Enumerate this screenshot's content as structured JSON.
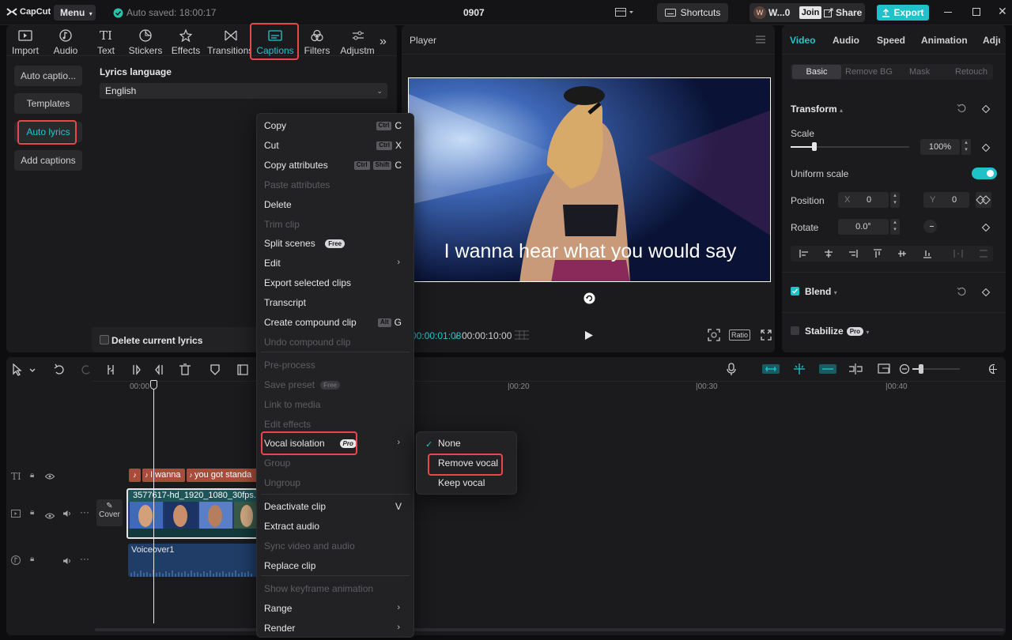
{
  "app": {
    "logo": "CapCut",
    "menu_label": "Menu",
    "auto_saved": "Auto saved: 18:00:17",
    "project_name": "0907",
    "shortcuts": "Shortcuts",
    "user_initial": "W",
    "user_name": "W...0",
    "join": "Join",
    "share": "Share",
    "export": "Export"
  },
  "toolbar": {
    "tabs": [
      "Import",
      "Audio",
      "Text",
      "Stickers",
      "Effects",
      "Transitions",
      "Captions",
      "Filters",
      "Adjustm"
    ]
  },
  "captions": {
    "side": [
      "Auto captio...",
      "Templates",
      "Auto lyrics",
      "Add captions"
    ],
    "lang_label": "Lyrics language",
    "lang_value": "English",
    "delete_label": "Delete current lyrics"
  },
  "player": {
    "title": "Player",
    "subtitle": "I wanna hear what you would say",
    "time_current": "00:00:01:08",
    "time_total": "00:00:10:00",
    "ratio": "Ratio"
  },
  "inspector": {
    "tabs": [
      "Video",
      "Audio",
      "Speed",
      "Animation",
      "Adju"
    ],
    "subtabs": [
      "Basic",
      "Remove BG",
      "Mask",
      "Retouch"
    ],
    "transform": "Transform",
    "scale": "Scale",
    "scale_value": "100%",
    "uniform_scale": "Uniform scale",
    "position": "Position",
    "x_label": "X",
    "x_value": "0",
    "y_label": "Y",
    "y_value": "0",
    "rotate": "Rotate",
    "rotate_value": "0.0°",
    "blend": "Blend",
    "stabilize": "Stabilize",
    "pro": "Pro",
    "scale_level": 0.1
  },
  "timeline": {
    "ticks": [
      "00:00",
      "|00:20",
      "|00:30",
      "|00:40"
    ],
    "caption_clips": [
      "I wanna",
      "you got standa"
    ],
    "video_clip": "3577617-hd_1920_1080_30fps.mp",
    "cover": "Cover",
    "voiceover": "Voiceover1"
  },
  "context_menu": {
    "items": [
      {
        "label": "Copy",
        "keys": [
          "Ctrl"
        ],
        "key": "C",
        "disabled": false
      },
      {
        "label": "Cut",
        "keys": [
          "Ctrl"
        ],
        "key": "X",
        "disabled": false
      },
      {
        "label": "Copy attributes",
        "keys": [
          "Ctrl",
          "Shift"
        ],
        "key": "C",
        "disabled": false
      },
      {
        "label": "Paste attributes",
        "disabled": true
      },
      {
        "label": "Delete",
        "disabled": false
      },
      {
        "label": "Trim clip",
        "disabled": true
      },
      {
        "label": "Split scenes",
        "badge": "Free",
        "disabled": false
      },
      {
        "label": "Edit",
        "arrow": true,
        "disabled": false
      },
      {
        "label": "Export selected clips",
        "disabled": false
      },
      {
        "label": "Transcript",
        "disabled": false
      },
      {
        "label": "Create compound clip",
        "keys": [
          "Alt"
        ],
        "key": "G",
        "disabled": false
      },
      {
        "label": "Undo compound clip",
        "disabled": true
      },
      {
        "label": "Pre-process",
        "disabled": true
      },
      {
        "label": "Save preset",
        "badge": "Free",
        "disabled": true
      },
      {
        "label": "Link to media",
        "disabled": true
      },
      {
        "label": "Edit effects",
        "disabled": true
      },
      {
        "label": "Vocal isolation",
        "badge": "Pro",
        "arrow": true,
        "disabled": false
      },
      {
        "label": "Group",
        "disabled": true
      },
      {
        "label": "Ungroup",
        "disabled": true
      },
      {
        "label": "Deactivate clip",
        "key": "V",
        "disabled": false
      },
      {
        "label": "Extract audio",
        "disabled": false
      },
      {
        "label": "Sync video and audio",
        "disabled": true
      },
      {
        "label": "Replace clip",
        "disabled": false
      },
      {
        "label": "Show keyframe animation",
        "disabled": true
      },
      {
        "label": "Range",
        "arrow": true,
        "disabled": false
      },
      {
        "label": "Render",
        "arrow": true,
        "disabled": false
      }
    ]
  },
  "submenu": {
    "items": [
      "None",
      "Remove vocal",
      "Keep vocal"
    ],
    "checked": "None"
  }
}
